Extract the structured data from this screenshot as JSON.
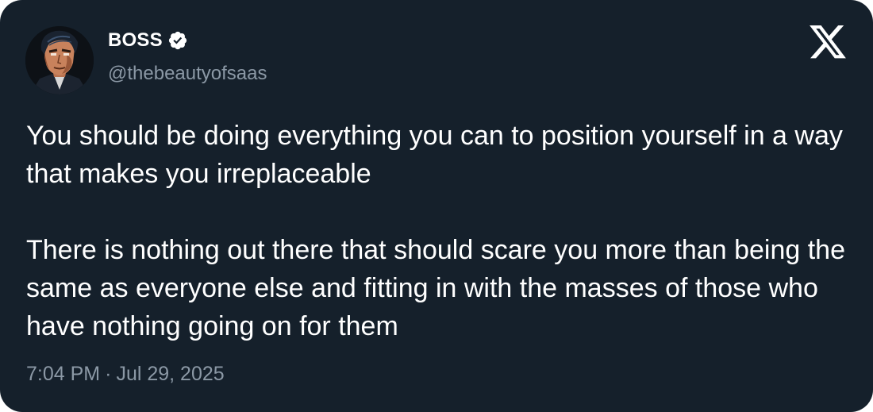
{
  "author": {
    "display_name": "BOSS",
    "handle": "@thebeautyofsaas",
    "verified": true,
    "avatar_icon": "comic-portrait-avatar"
  },
  "brand": {
    "logo_icon": "x-logo-icon"
  },
  "tweet": {
    "paragraphs": [
      "You should be doing everything you can to position yourself in a way that makes you irreplaceable",
      "There is nothing out there that should scare you more than being the same as everyone else and fitting in with the masses of those who have nothing going on for them"
    ],
    "time": "7:04 PM",
    "separator": "·",
    "date": "Jul 29, 2025"
  },
  "colors": {
    "background": "#15202b",
    "text_primary": "#ffffff",
    "text_secondary": "#8b98a5",
    "verified_badge": "#ffffff"
  }
}
